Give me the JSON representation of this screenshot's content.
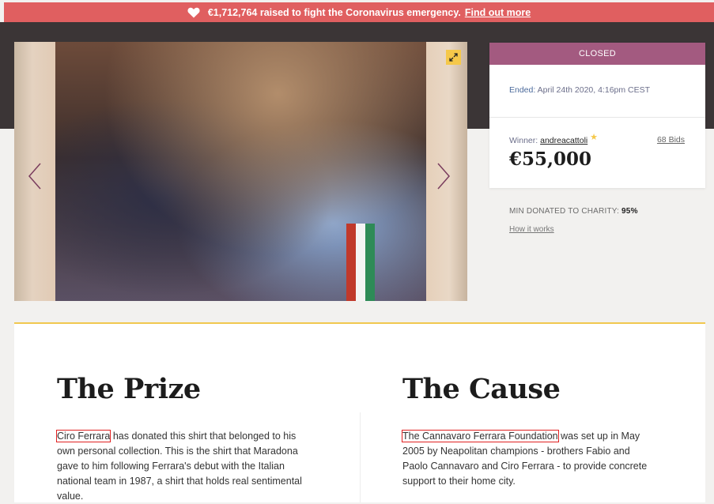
{
  "banner": {
    "text": "€1,712,764 raised to fight the Coronavirus emergency.",
    "link": "Find out more",
    "icon": "heart-icon"
  },
  "gallery": {
    "prev_icon": "chevron-left-icon",
    "next_icon": "chevron-right-icon",
    "fullscreen_icon": "expand-icon"
  },
  "auction": {
    "status": "CLOSED",
    "ended_label": "Ended:",
    "ended_value": "April 24th 2020, 4:16pm CEST",
    "winner_label": "Winner:",
    "winner_user": "andreacattoli",
    "bids": "68 Bids",
    "amount": "€55,000",
    "charity_label": "MIN DONATED TO CHARITY:",
    "charity_value": "95%",
    "how_it_works": "How it works"
  },
  "prize": {
    "title": "The Prize",
    "link": "Ciro Ferrara",
    "text": "has donated this shirt that belonged to his own personal collection. This is the shirt that Maradona gave to him following Ferrara's debut with the Italian national team in 1987, a shirt that holds real sentimental value."
  },
  "cause": {
    "title": "The Cause",
    "link": "The Cannavaro Ferrara Foundation",
    "text": "was set up in May 2005 by Neapolitan champions - brothers Fabio and Paolo Cannavaro and Ciro Ferrara - to provide concrete support to their home city."
  },
  "colors": {
    "banner": "#e05f60",
    "status": "#a35a80",
    "accent": "#f1c84f"
  }
}
